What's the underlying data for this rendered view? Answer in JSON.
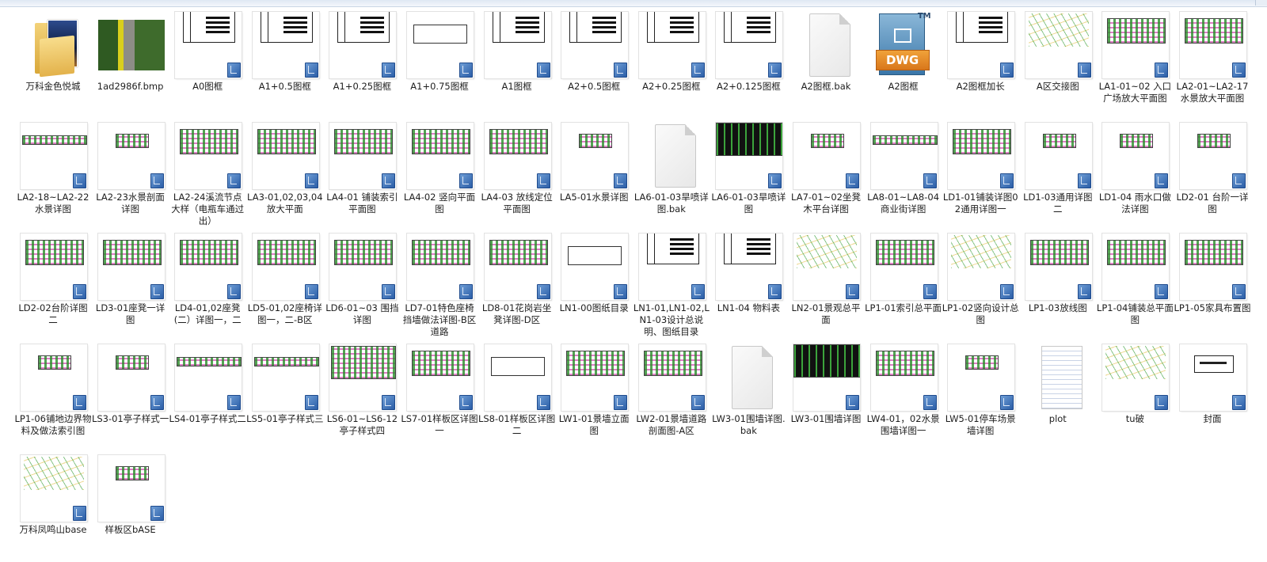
{
  "files": [
    {
      "name": "万科金色悦城",
      "kind": "folder"
    },
    {
      "name": "1ad2986f.bmp",
      "kind": "bmp"
    },
    {
      "name": "A0图框",
      "kind": "sheet-a"
    },
    {
      "name": "A1+0.5图框",
      "kind": "sheet-a"
    },
    {
      "name": "A1+0.25图框",
      "kind": "sheet-a"
    },
    {
      "name": "A1+0.75图框",
      "kind": "sheet-b"
    },
    {
      "name": "A1图框",
      "kind": "sheet-a"
    },
    {
      "name": "A2+0.5图框",
      "kind": "sheet-a"
    },
    {
      "name": "A2+0.25图框",
      "kind": "sheet-a"
    },
    {
      "name": "A2+0.125图框",
      "kind": "sheet-a"
    },
    {
      "name": "A2图框.bak",
      "kind": "blank"
    },
    {
      "name": "A2图框",
      "kind": "dwg"
    },
    {
      "name": "A2图框加长",
      "kind": "sheet-a"
    },
    {
      "name": "A区交接图",
      "kind": "cad"
    },
    {
      "name": "LA1-01~02 入口广场放大平面图",
      "kind": "plan"
    },
    {
      "name": "LA2-01~LA2-17水景放大平面图",
      "kind": "plan"
    },
    {
      "name": "LA2-18~LA2-22水景详图",
      "kind": "plan-wide"
    },
    {
      "name": "LA2-23水景剖面详图",
      "kind": "plan-small"
    },
    {
      "name": "LA2-24溪流节点大样（电瓶车通过出）",
      "kind": "plan"
    },
    {
      "name": "LA3-01,02,03,04放大平面",
      "kind": "plan"
    },
    {
      "name": "LA4-01 铺装索引平面图",
      "kind": "plan"
    },
    {
      "name": "LA4-02 竖向平面图",
      "kind": "plan"
    },
    {
      "name": "LA4-03 放线定位平面图",
      "kind": "plan"
    },
    {
      "name": "LA5-01水景详图",
      "kind": "plan-small"
    },
    {
      "name": "LA6-01-03旱喷详图.bak",
      "kind": "blank"
    },
    {
      "name": "LA6-01-03旱喷详图",
      "kind": "plan-dark"
    },
    {
      "name": "LA7-01~02坐凳木平台详图",
      "kind": "plan-small"
    },
    {
      "name": "LA8-01~LA8-04商业街详图",
      "kind": "plan-wide"
    },
    {
      "name": "LD1-01铺装详图02通用详图一",
      "kind": "plan"
    },
    {
      "name": "LD1-03通用详图二",
      "kind": "plan-small"
    },
    {
      "name": "LD1-04 雨水口做法详图",
      "kind": "plan-small"
    },
    {
      "name": "LD2-01 台阶一详图",
      "kind": "plan-small"
    },
    {
      "name": "LD2-02台阶详图二",
      "kind": "plan"
    },
    {
      "name": "LD3-01座凳一详图",
      "kind": "plan"
    },
    {
      "name": "LD4-01,02座凳(二）详图一，二",
      "kind": "plan"
    },
    {
      "name": "LD5-01,02座椅详图一，二-B区",
      "kind": "plan"
    },
    {
      "name": "LD6-01~03 围挡详图",
      "kind": "plan"
    },
    {
      "name": "LD7-01特色座椅挡墙做法详图-B区道路",
      "kind": "plan"
    },
    {
      "name": "LD8-01花岗岩坐凳详图-D区",
      "kind": "plan"
    },
    {
      "name": "LN1-00图纸目录",
      "kind": "sheet-b"
    },
    {
      "name": "LN1-01,LN1-02,LN1-03设计总说明、图纸目录",
      "kind": "sheet-a"
    },
    {
      "name": "LN1-04 物料表",
      "kind": "sheet-a"
    },
    {
      "name": "LN2-01景观总平面",
      "kind": "cad"
    },
    {
      "name": "LP1-01索引总平面",
      "kind": "plan"
    },
    {
      "name": "LP1-02竖向设计总图",
      "kind": "cad"
    },
    {
      "name": "LP1-03放线图",
      "kind": "plan"
    },
    {
      "name": "LP1-04铺装总平面图",
      "kind": "plan"
    },
    {
      "name": "LP1-05家具布置图",
      "kind": "plan"
    },
    {
      "name": "LP1-06铺地边界物料及做法索引图",
      "kind": "plan-small"
    },
    {
      "name": "LS3-01亭子样式一",
      "kind": "plan-small"
    },
    {
      "name": "LS4-01亭子样式二",
      "kind": "plan-wide"
    },
    {
      "name": "LS5-01亭子样式三",
      "kind": "plan-wide"
    },
    {
      "name": "LS6-01~LS6-12亭子样式四",
      "kind": "plan-dense"
    },
    {
      "name": "LS7-01样板区详图一",
      "kind": "plan"
    },
    {
      "name": "LS8-01样板区详图二",
      "kind": "sheet-b"
    },
    {
      "name": "LW1-01景墙立面图",
      "kind": "plan"
    },
    {
      "name": "LW2-01景墙道路剖面图-A区",
      "kind": "plan"
    },
    {
      "name": "LW3-01围墙详图.bak",
      "kind": "blank"
    },
    {
      "name": "LW3-01围墙详图",
      "kind": "plan-dark"
    },
    {
      "name": "LW4-01，02水景围墙详图一",
      "kind": "plan"
    },
    {
      "name": "LW5-01停车场景墙详图",
      "kind": "plan-small"
    },
    {
      "name": "plot",
      "kind": "plot"
    },
    {
      "name": "tu破",
      "kind": "cad"
    },
    {
      "name": "封面",
      "kind": "cover"
    },
    {
      "name": "万科凤鸣山base",
      "kind": "cad"
    },
    {
      "name": "样板区bASE",
      "kind": "plan-small"
    }
  ],
  "dwg_logo": {
    "band": "DWG",
    "tm": "TM"
  }
}
